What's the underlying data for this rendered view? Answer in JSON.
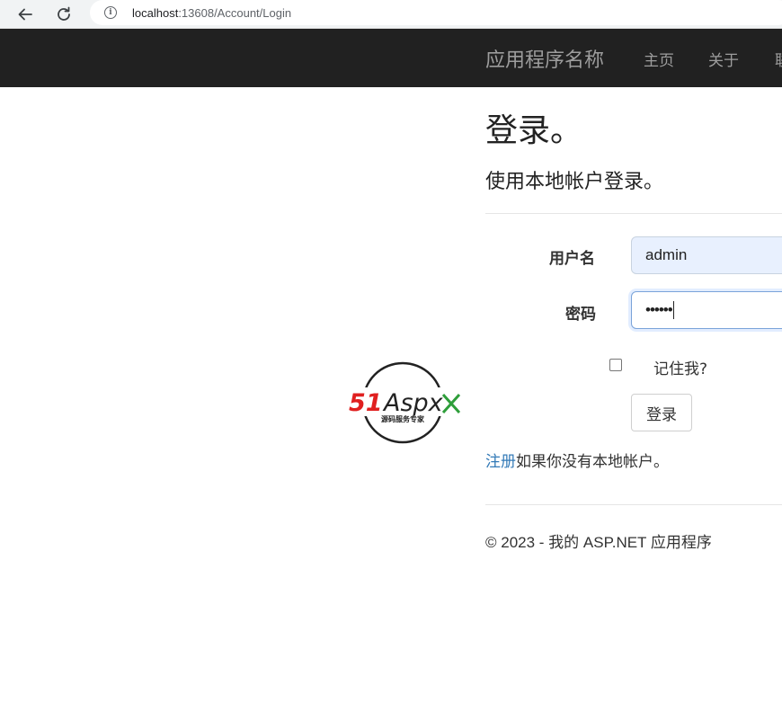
{
  "browser": {
    "url_host": "localhost",
    "url_path": ":13608/Account/Login"
  },
  "navbar": {
    "brand": "应用程序名称",
    "links": [
      "主页",
      "关于",
      "联"
    ]
  },
  "page": {
    "title": "登录。",
    "subtitle": "使用本地帐户登录。"
  },
  "form": {
    "username_label": "用户名",
    "username_value": "admin",
    "password_label": "密码",
    "password_value": "••••••",
    "remember_label": "记住我?",
    "remember_checked": false,
    "submit_label": "登录"
  },
  "register": {
    "link_text": "注册",
    "suffix_text": "如果你没有本地帐户。"
  },
  "footer": {
    "text": "© 2023 - 我的 ASP.NET 应用程序"
  },
  "watermark": {
    "brand_red": "51",
    "brand_dark": "Aspx",
    "slogan": "源码服务专家"
  },
  "colors": {
    "navbar_bg": "#212121",
    "nav_text": "#9d9d9d",
    "link": "#337ab7",
    "autofill_bg": "#e8f0fe",
    "logo_red": "#e02020",
    "logo_green": "#2e9e3a"
  }
}
